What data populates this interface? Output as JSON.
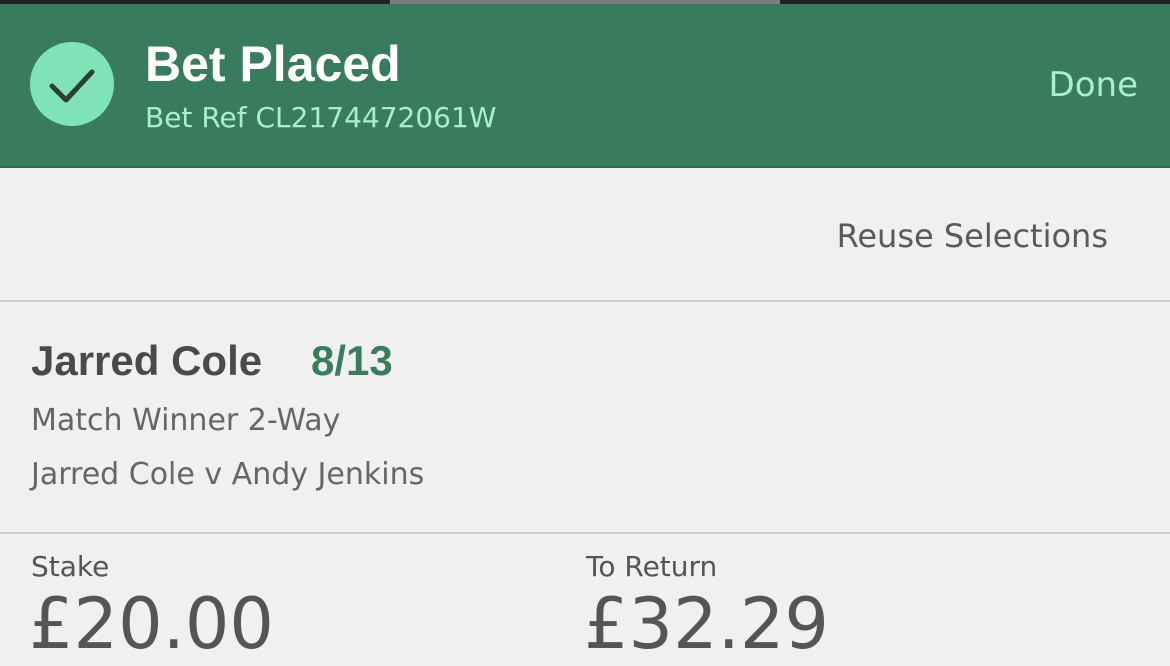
{
  "header": {
    "title": "Bet Placed",
    "bet_ref": "Bet Ref CL2174472061W",
    "done_label": "Done"
  },
  "actions": {
    "reuse_label": "Reuse Selections"
  },
  "selection": {
    "name": "Jarred Cole",
    "odds": "8/13",
    "market": "Match Winner 2-Way",
    "event": "Jarred Cole v Andy Jenkins"
  },
  "summary": {
    "stake_label": "Stake",
    "stake_value": "£20.00",
    "return_label": "To Return",
    "return_value": "£32.29"
  },
  "colors": {
    "header_bg": "#397b5d",
    "accent_light": "#a7efcd",
    "check_circle": "#7fe3b6",
    "odds_green": "#3a7d5d"
  },
  "icons": {
    "confirmation": "checkmark-icon"
  }
}
